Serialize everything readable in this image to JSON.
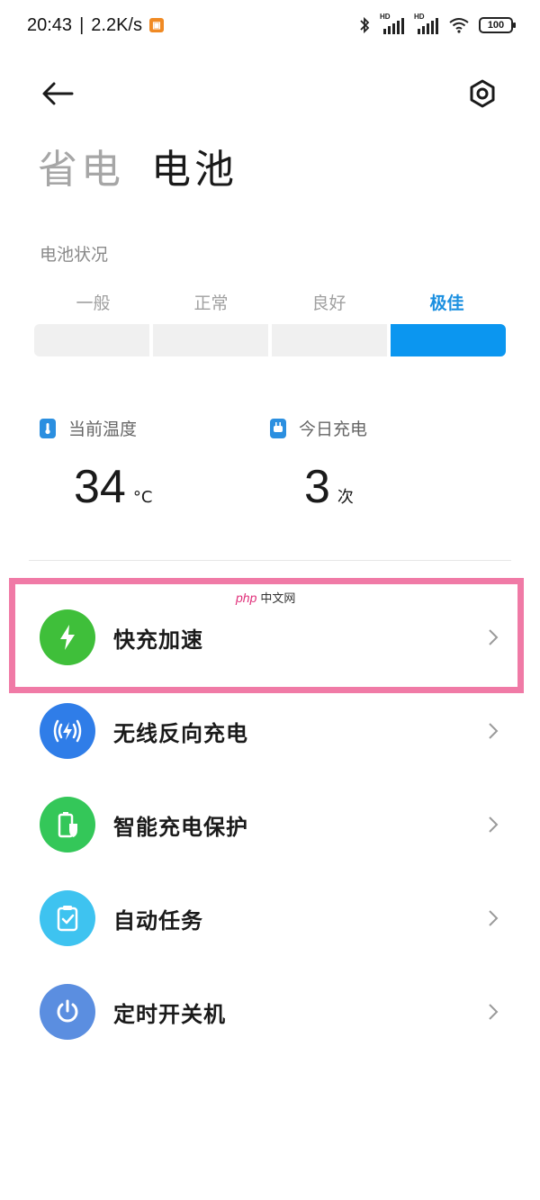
{
  "status_bar": {
    "time": "20:43",
    "net_speed": "2.2K/s",
    "signal_hd_1": "HD",
    "signal_hd_2": "HD",
    "battery": "100"
  },
  "header": {
    "tabs": [
      {
        "label": "省电",
        "active": false
      },
      {
        "label": "电池",
        "active": true
      }
    ]
  },
  "battery_status": {
    "label": "电池状况",
    "levels": [
      "一般",
      "正常",
      "良好",
      "极佳"
    ],
    "current_level_index": 3
  },
  "stats": {
    "temperature": {
      "label": "当前温度",
      "value": "34",
      "unit": "°C"
    },
    "charges_today": {
      "label": "今日充电",
      "value": "3",
      "unit": "次"
    }
  },
  "menu": [
    {
      "label": "快充加速",
      "icon": "lightning-icon",
      "color": "#3fbf3a"
    },
    {
      "label": "无线反向充电",
      "icon": "wireless-charge-icon",
      "color": "#2f7de8"
    },
    {
      "label": "智能充电保护",
      "icon": "battery-shield-icon",
      "color": "#34c759"
    },
    {
      "label": "自动任务",
      "icon": "clipboard-check-icon",
      "color": "#3ec3f0"
    },
    {
      "label": "定时开关机",
      "icon": "power-icon",
      "color": "#5b8ee0"
    }
  ],
  "watermark": {
    "brand": "php",
    "suffix": "中文网"
  },
  "colors": {
    "accent": "#0b96f0",
    "highlight_border": "#f07aa6",
    "inactive_text": "#a6a6a6"
  }
}
